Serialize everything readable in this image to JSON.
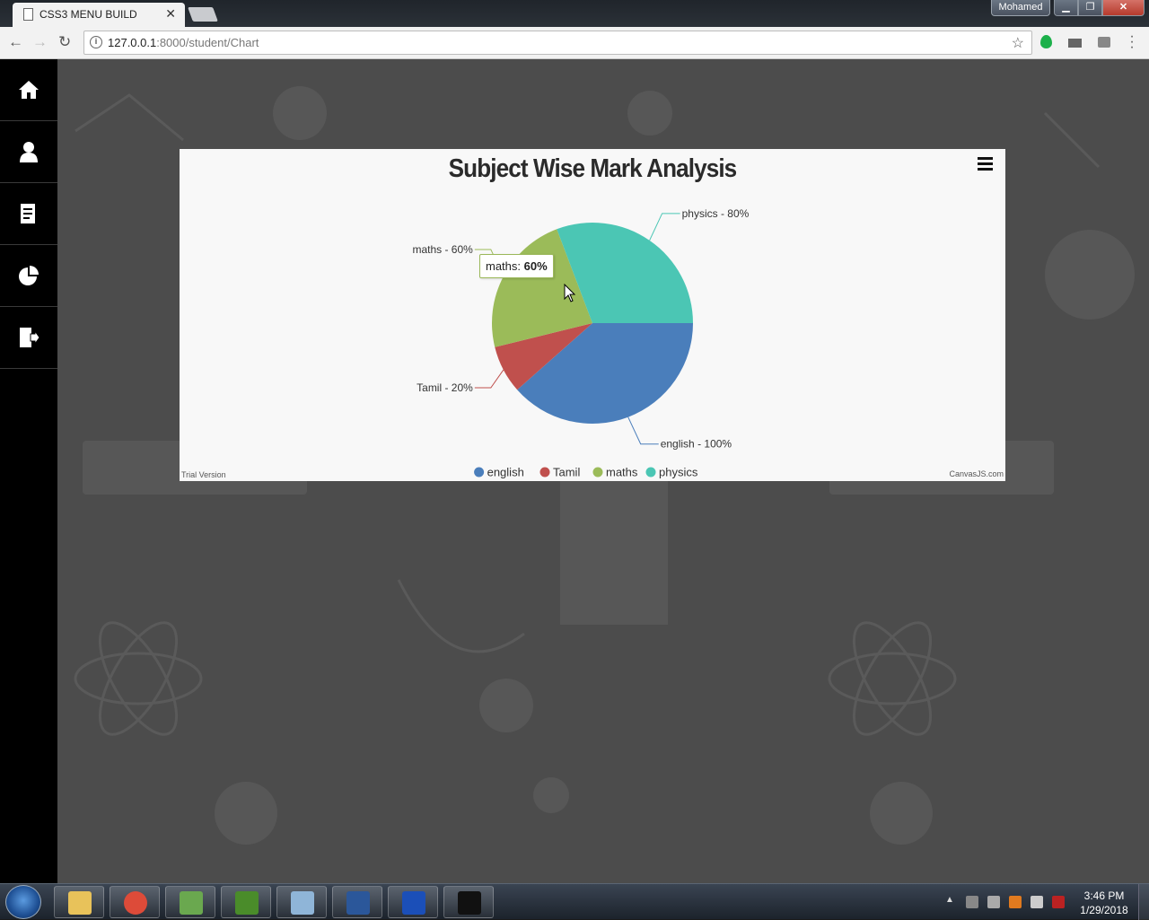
{
  "browser": {
    "tab_title": "CSS3 MENU BUILD",
    "tab_close": "✕",
    "profile_name": "Mohamed",
    "url_host": "127.0.0.1",
    "url_path": ":8000/student/Chart"
  },
  "sidebar": {
    "items": [
      {
        "icon": "home-icon"
      },
      {
        "icon": "user-icon"
      },
      {
        "icon": "document-edit-icon"
      },
      {
        "icon": "pie-chart-icon"
      },
      {
        "icon": "logout-icon"
      }
    ]
  },
  "chart": {
    "trial_label": "Trial Version",
    "credit_label": "CanvasJS.com",
    "tooltip": {
      "label": "maths:",
      "value": "60%"
    }
  },
  "chart_data": {
    "type": "pie",
    "title": "Subject Wise Mark Analysis",
    "categories": [
      "english",
      "Tamil",
      "maths",
      "physics"
    ],
    "values": [
      100,
      20,
      60,
      80
    ],
    "index_labels": [
      "english - 100%",
      "Tamil - 20%",
      "maths - 60%",
      "physics - 80%"
    ],
    "colors": [
      "#4a7ebb",
      "#c0504d",
      "#9bbb59",
      "#4bc6b4"
    ],
    "legend_position": "bottom"
  },
  "taskbar": {
    "time": "3:46 PM",
    "date": "1/29/2018",
    "apps": [
      "file-explorer-icon",
      "chrome-icon",
      "chameleon-app-icon",
      "notepad-plus-plus-icon",
      "notepad-icon",
      "word-icon",
      "taskbar-app-icon",
      "command-prompt-icon"
    ]
  }
}
